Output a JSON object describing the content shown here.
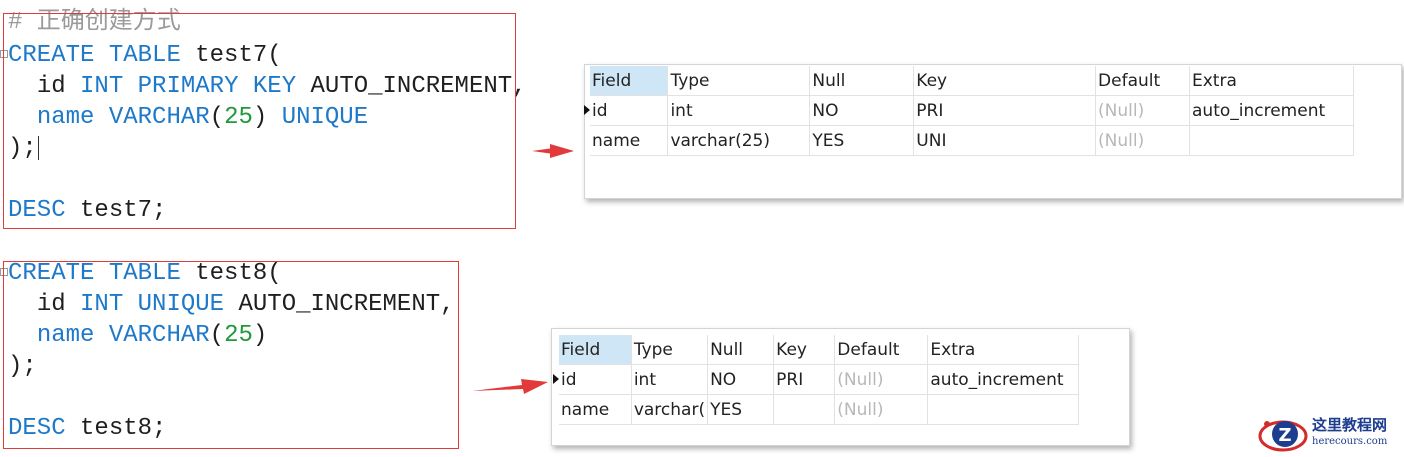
{
  "editor1": {
    "comment": "# 正确创建方式",
    "line1": {
      "kw1": "CREATE",
      "kw2": "TABLE",
      "name": "test7("
    },
    "line2": {
      "col": "id",
      "kw1": "INT",
      "kw2": "PRIMARY",
      "kw3": "KEY",
      "rest": "AUTO_INCREMENT,"
    },
    "line3": {
      "col": "name",
      "type": "VARCHAR",
      "open": "(",
      "num": "25",
      "close": ")",
      "kw": "UNIQUE"
    },
    "line4": ");",
    "line5": {
      "kw": "DESC",
      "rest": "test7;"
    }
  },
  "editor2": {
    "line1": {
      "kw1": "CREATE",
      "kw2": "TABLE",
      "name": "test8("
    },
    "line2": {
      "col": "id",
      "kw1": "INT",
      "kw2": "UNIQUE",
      "rest": "AUTO_INCREMENT,"
    },
    "line3": {
      "col": "name",
      "type": "VARCHAR",
      "open": "(",
      "num": "25",
      "close": ")"
    },
    "line4": ");",
    "line5": {
      "kw": "DESC",
      "rest": "test8;"
    }
  },
  "result1": {
    "headers": [
      "Field",
      "Type",
      "Null",
      "Key",
      "Default",
      "Extra"
    ],
    "rows": [
      [
        "id",
        "int",
        "NO",
        "PRI",
        "(Null)",
        "auto_increment"
      ],
      [
        "name",
        "varchar(25)",
        "YES",
        "UNI",
        "(Null)",
        ""
      ]
    ]
  },
  "result2": {
    "headers": [
      "Field",
      "Type",
      "Null",
      "Key",
      "Default",
      "Extra"
    ],
    "rows": [
      [
        "id",
        "int",
        "NO",
        "PRI",
        "(Null)",
        "auto_increment"
      ],
      [
        "name",
        "varchar(",
        "YES",
        "",
        "(Null)",
        ""
      ]
    ]
  },
  "watermark": {
    "title": "这里教程网",
    "url": "herecours.com"
  },
  "colors": {
    "keyword": "#1e79c9",
    "number": "#1f9a3a",
    "highlight_box": "#e23a3a",
    "arrow": "#e23a3a",
    "selected_header": "#cfe6f7",
    "null_text": "#b8b8b8"
  }
}
